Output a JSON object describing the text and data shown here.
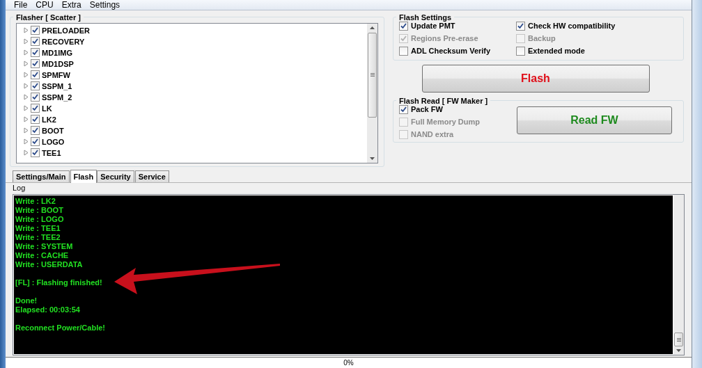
{
  "menu": [
    "File",
    "CPU",
    "Extra",
    "Settings"
  ],
  "flasher": {
    "title": "Flasher [ Scatter ]",
    "items": [
      {
        "label": "PRELOADER",
        "checked": true
      },
      {
        "label": "RECOVERY",
        "checked": true
      },
      {
        "label": "MD1IMG",
        "checked": true
      },
      {
        "label": "MD1DSP",
        "checked": true
      },
      {
        "label": "SPMFW",
        "checked": true
      },
      {
        "label": "SSPM_1",
        "checked": true
      },
      {
        "label": "SSPM_2",
        "checked": true
      },
      {
        "label": "LK",
        "checked": true
      },
      {
        "label": "LK2",
        "checked": true
      },
      {
        "label": "BOOT",
        "checked": true
      },
      {
        "label": "LOGO",
        "checked": true
      },
      {
        "label": "TEE1",
        "checked": true
      }
    ]
  },
  "flash_settings": {
    "title": "Flash Settings",
    "options": [
      {
        "label": "Update PMT",
        "checked": true,
        "disabled": false
      },
      {
        "label": "Check HW compatibility",
        "checked": true,
        "disabled": false
      },
      {
        "label": "Regions Pre-erase",
        "checked": true,
        "disabled": true
      },
      {
        "label": "Backup",
        "checked": false,
        "disabled": true
      },
      {
        "label": "ADL Checksum Verify",
        "checked": false,
        "disabled": false
      },
      {
        "label": "Extended mode",
        "checked": false,
        "disabled": false
      }
    ]
  },
  "flash_button": "Flash",
  "flash_read": {
    "title": "Flash Read [ FW Maker ]",
    "options": [
      {
        "label": "Pack FW",
        "checked": true,
        "disabled": false
      },
      {
        "label": "Full Memory Dump",
        "checked": false,
        "disabled": true
      },
      {
        "label": "NAND extra",
        "checked": false,
        "disabled": true
      }
    ],
    "button": "Read FW"
  },
  "tabs": [
    {
      "label": "Settings/Main",
      "selected": false
    },
    {
      "label": "Flash",
      "selected": true
    },
    {
      "label": "Security",
      "selected": false
    },
    {
      "label": "Service",
      "selected": false
    }
  ],
  "log": {
    "title": "Log",
    "blocks": [
      {
        "lines": [
          "Write : LK2",
          "Write : BOOT",
          "Write : LOGO",
          "Write : TEE1",
          "Write : TEE2",
          "Write : SYSTEM",
          "Write : CACHE",
          "Write : USERDATA"
        ]
      },
      {
        "lines": [
          "[FL] : Flashing finished!"
        ]
      },
      {
        "lines": [
          "Done!",
          "Elapsed: 00:03:54"
        ]
      },
      {
        "lines": [
          "Reconnect Power/Cable!"
        ]
      }
    ]
  },
  "progress": {
    "level": 0,
    "text": "0%"
  }
}
